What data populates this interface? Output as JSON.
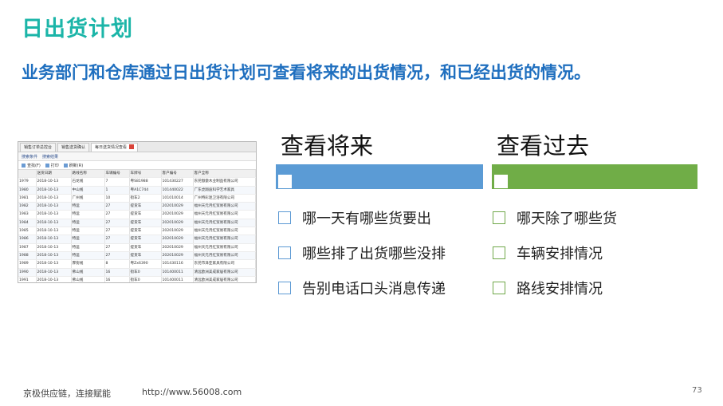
{
  "title": "日出货计划",
  "subtitle": "业务部门和仓库通过日出货计划可查看将来的出货情况，和已经出货的情况。",
  "screenshot": {
    "tabs": [
      {
        "label": "销售订单总控台",
        "active": false
      },
      {
        "label": "销售送货确认",
        "active": false
      },
      {
        "label": "每日送货情况查看",
        "active": true
      }
    ],
    "subtabs": [
      "搜索条件",
      "搜索结果"
    ],
    "toolbar": [
      "查找(F)",
      "打印",
      "刷新(R)"
    ],
    "columns": [
      "",
      "送货日期",
      "路线名称",
      "车辆编号",
      "车牌号",
      "客户编号",
      "客户全称"
    ],
    "rows": [
      [
        "1979",
        "2018-10-13",
        "石龙线",
        "7",
        "粤S81988",
        "101430227",
        "东莞傲傲木业制品有限公司"
      ],
      [
        "1980",
        "2018-10-13",
        "中山线",
        "1",
        "粤A1C744",
        "101440022",
        "广东虎翔迪科学艺术家具"
      ],
      [
        "1981",
        "2018-10-13",
        "广州线",
        "10",
        "街车2",
        "101010014",
        "广州特彩迷卫浴有限公司"
      ],
      [
        "1982",
        "2018-10-13",
        "特运",
        "27",
        "提货车",
        "202010029",
        "福州天元月红贸易有限公司"
      ],
      [
        "1983",
        "2018-10-13",
        "特运",
        "27",
        "提货车",
        "202010029",
        "福州天元月红贸易有限公司"
      ],
      [
        "1984",
        "2018-10-13",
        "特运",
        "27",
        "提货车",
        "202010029",
        "福州天元月红贸易有限公司"
      ],
      [
        "1985",
        "2018-10-13",
        "特运",
        "27",
        "提货车",
        "202010029",
        "福州天元月红贸易有限公司"
      ],
      [
        "1986",
        "2018-10-13",
        "特运",
        "27",
        "提货车",
        "202010029",
        "福州天元月红贸易有限公司"
      ],
      [
        "1987",
        "2018-10-13",
        "特运",
        "27",
        "提货车",
        "202010029",
        "福州天元月红贸易有限公司"
      ],
      [
        "1988",
        "2018-10-13",
        "特运",
        "27",
        "提货车",
        "202010029",
        "福州天元月红贸易有限公司"
      ],
      [
        "1989",
        "2018-10-13",
        "厚街线",
        "8",
        "粤Zx6390",
        "101430116",
        "东莞市泽亚家具有限公司"
      ],
      [
        "1990",
        "2018-10-13",
        "佛山线",
        "16",
        "街车0",
        "101400011",
        "清远欧洲美成家居有限公司"
      ],
      [
        "1991",
        "2018-10-13",
        "佛山线",
        "16",
        "街车0",
        "101400011",
        "清远欧洲美成家居有限公司"
      ]
    ]
  },
  "future": {
    "heading": "查看将来",
    "color": "#5b9bd5",
    "items": [
      "哪一天有哪些货要出",
      "哪些排了出货哪些没排",
      "告别电话口头消息传递"
    ]
  },
  "past": {
    "heading": "查看过去",
    "color": "#70ad47",
    "items": [
      "哪天除了哪些货",
      "车辆安排情况",
      "路线安排情况"
    ]
  },
  "footer": {
    "slogan": "京极供应链，连接赋能",
    "url": "http://www.56008.com",
    "page": "73"
  }
}
